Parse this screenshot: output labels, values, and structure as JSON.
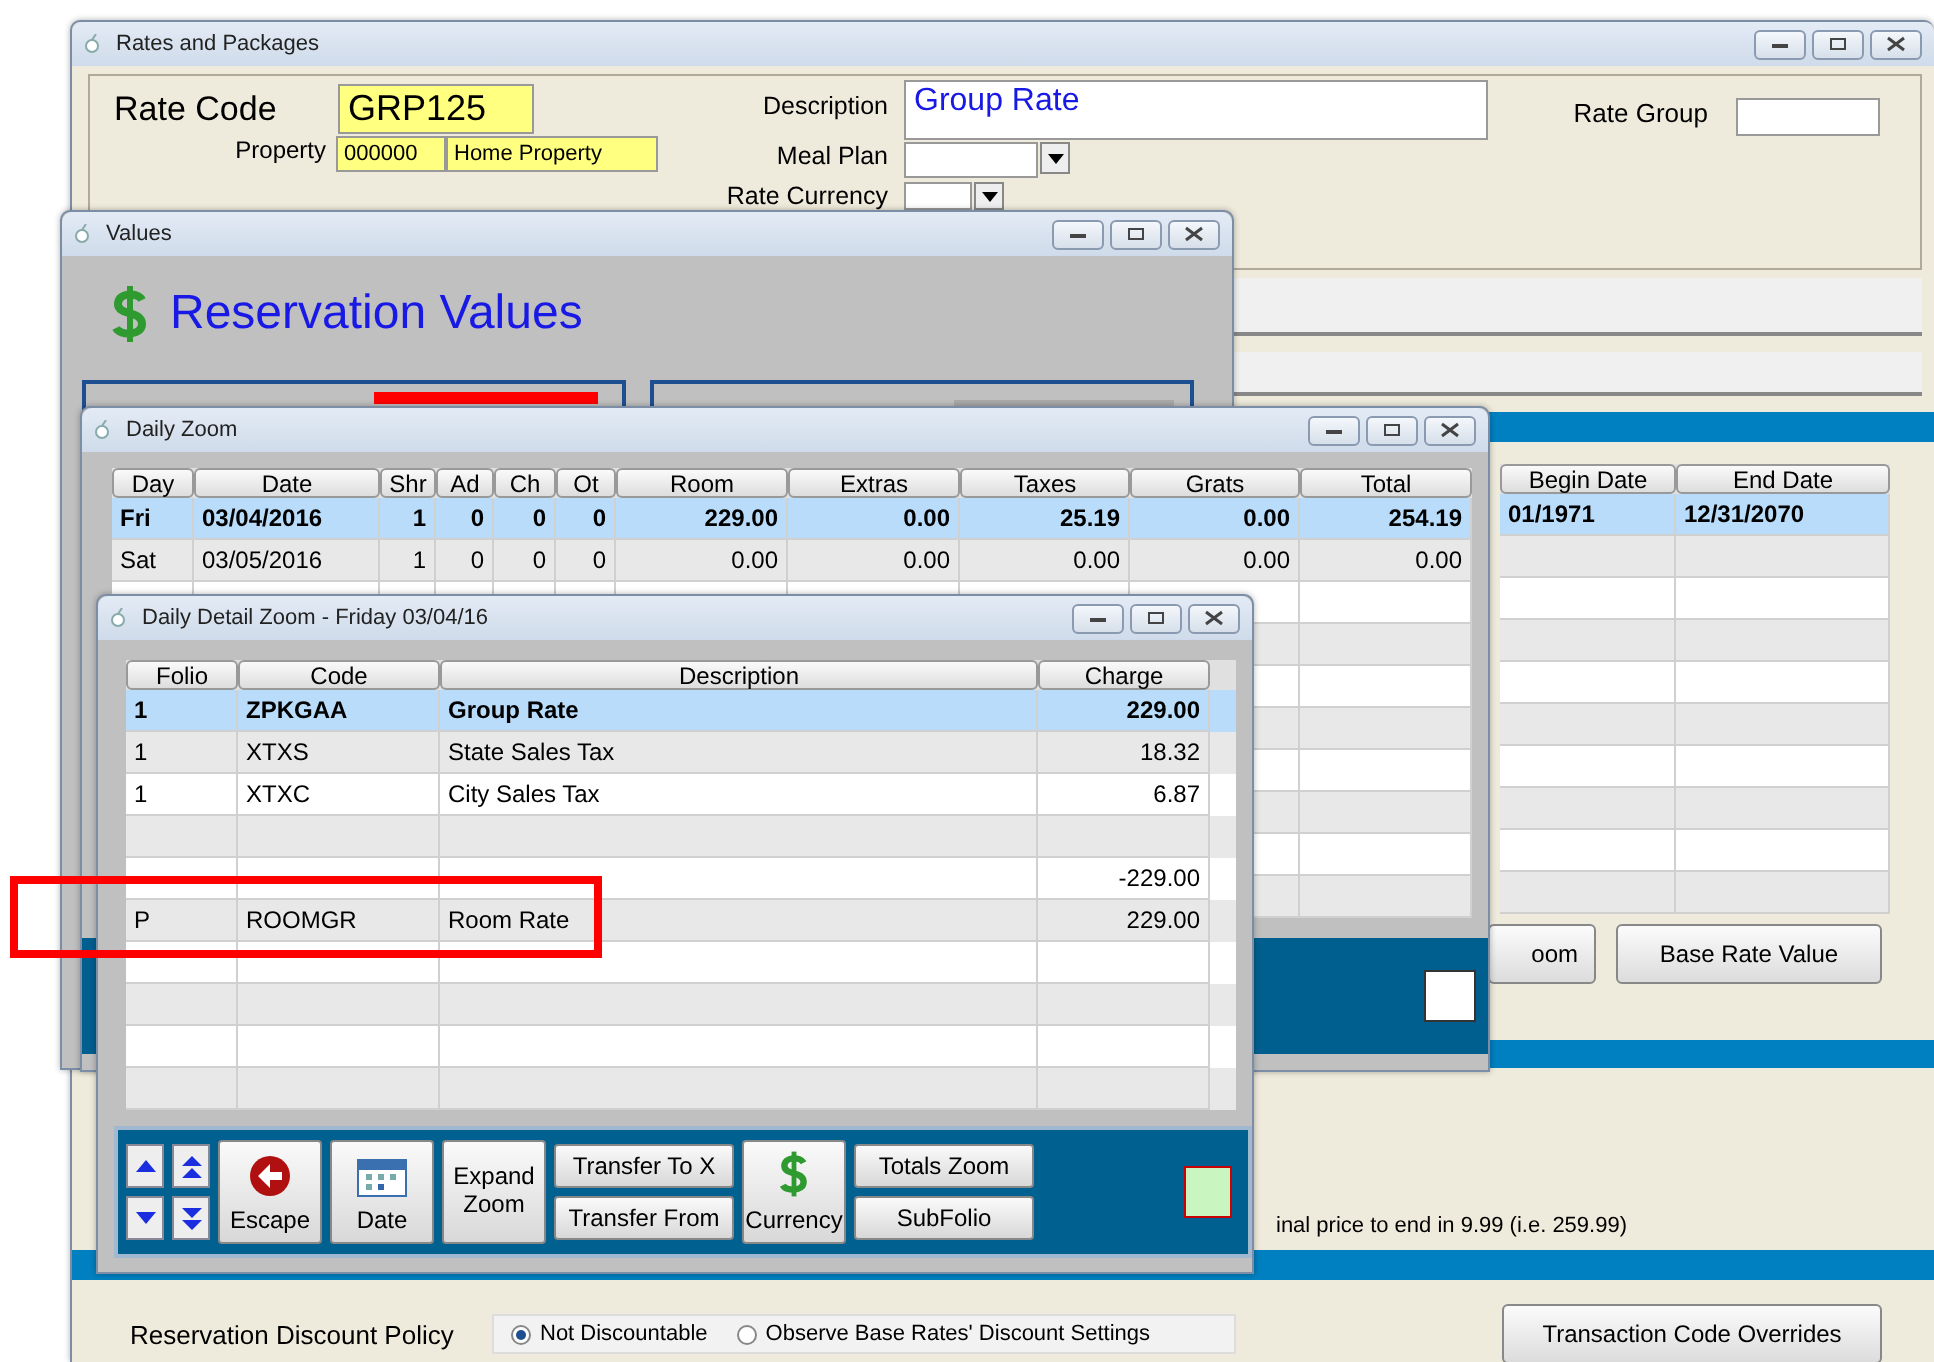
{
  "main_window": {
    "title": "Rates and Packages",
    "rate_code": {
      "label": "Rate Code",
      "value": "GRP125"
    },
    "property": {
      "label": "Property",
      "code": "000000",
      "name": "Home Property"
    },
    "description": {
      "label": "Description",
      "value": "Group Rate"
    },
    "meal_plan": {
      "label": "Meal Plan"
    },
    "rate_currency": {
      "label": "Rate Currency"
    },
    "rate_group": {
      "label": "Rate Group"
    },
    "date_grid": {
      "columns": [
        "Begin Date",
        "End Date"
      ],
      "rows": [
        {
          "cells": [
            "01/1971",
            "12/31/2070"
          ],
          "selected": true
        }
      ]
    },
    "buttons": [
      "oom",
      "Base Rate Value"
    ],
    "rounding_note": "inal price to end in 9.99 (i.e. 259.99)",
    "discount_policy": {
      "label": "Reservation Discount Policy",
      "options": [
        {
          "label": "Not Discountable",
          "selected": true
        },
        {
          "label": "Observe Base Rates' Discount Settings",
          "selected": false
        }
      ]
    },
    "overrides_button": "Transaction Code Overrides"
  },
  "values_window": {
    "title": "Values",
    "heading": "Reservation Values"
  },
  "daily_zoom": {
    "title": "Daily Zoom",
    "columns": [
      "Day",
      "Date",
      "Shr",
      "Ad",
      "Ch",
      "Ot",
      "Room",
      "Extras",
      "Taxes",
      "Grats",
      "Total"
    ],
    "rows": [
      {
        "cells": [
          "Fri",
          "03/04/2016",
          "1",
          "0",
          "0",
          "0",
          "229.00",
          "0.00",
          "25.19",
          "0.00",
          "254.19"
        ],
        "selected": true
      },
      {
        "cells": [
          "Sat",
          "03/05/2016",
          "1",
          "0",
          "0",
          "0",
          "0.00",
          "0.00",
          "0.00",
          "0.00",
          "0.00"
        ],
        "selected": false
      }
    ]
  },
  "detail_zoom": {
    "title": "Daily Detail Zoom - Friday 03/04/16",
    "columns": [
      "Folio",
      "Code",
      "Description",
      "Charge"
    ],
    "rows": [
      {
        "folio": "1",
        "code": "ZPKGAA",
        "description": "Group Rate",
        "charge": "229.00",
        "selected": true
      },
      {
        "folio": "1",
        "code": "XTXS",
        "description": "State Sales Tax",
        "charge": "18.32",
        "selected": false
      },
      {
        "folio": "1",
        "code": "XTXC",
        "description": "City Sales Tax",
        "charge": "6.87",
        "selected": false
      },
      {
        "selected": false
      },
      {
        "charge": "-229.00",
        "selected": false
      },
      {
        "folio": "P",
        "code": "ROOMGR",
        "description": "Room Rate",
        "charge": "229.00",
        "selected": false
      }
    ],
    "toolbar": [
      {
        "kind": "icon",
        "label": "Escape"
      },
      {
        "kind": "icon",
        "label": "Date"
      },
      {
        "kind": "plain",
        "label": "Expand Zoom"
      },
      {
        "kind": "stack",
        "labels": [
          "Transfer To X",
          "Transfer From"
        ]
      },
      {
        "kind": "icon",
        "label": "Currency"
      },
      {
        "kind": "stack",
        "labels": [
          "Totals Zoom",
          "SubFolio"
        ]
      }
    ]
  }
}
